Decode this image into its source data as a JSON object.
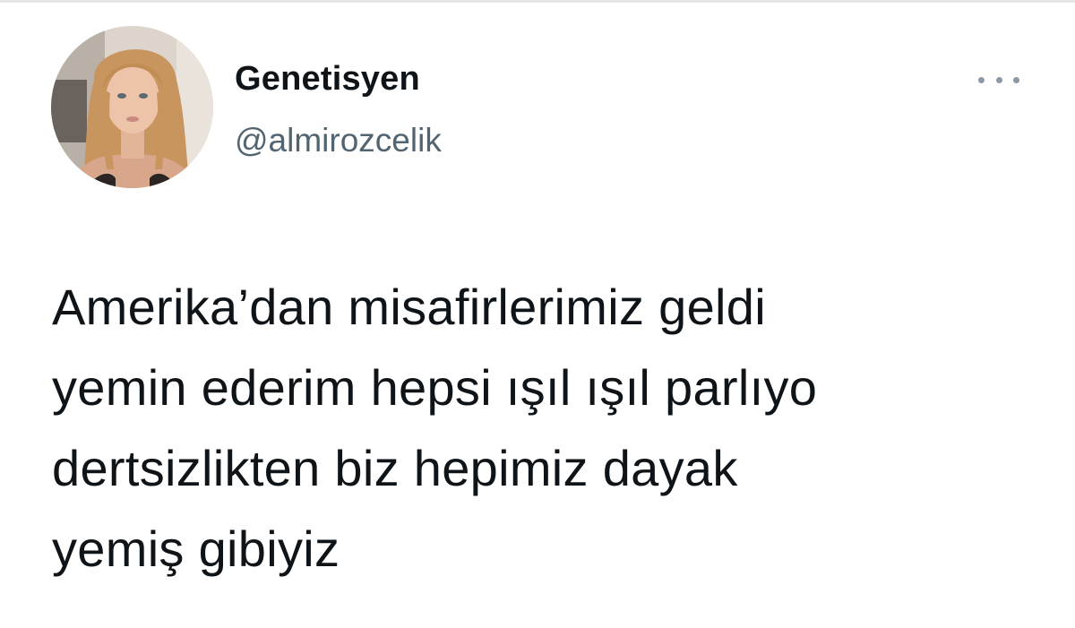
{
  "tweet": {
    "author": {
      "display_name": "Genetisyen",
      "handle": "@almirozcelik",
      "avatar_icon": "profile-photo"
    },
    "more_icon": "more-horizontal-icon",
    "text_lines": [
      "Amerika’dan misafirlerimiz geldi",
      "yemin ederim hepsi ışıl ışıl parlıyo",
      "dertsizlikten biz hepimiz dayak",
      "yemiş gibiyiz"
    ]
  },
  "colors": {
    "text_primary": "#0f1419",
    "text_secondary": "#536471",
    "icon_gray": "#8b98a5",
    "background": "#ffffff"
  }
}
